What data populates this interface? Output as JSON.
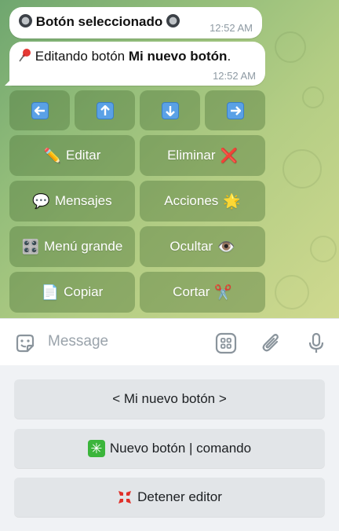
{
  "messages": [
    {
      "icon_left": "radio-circle-icon",
      "text": "Botón seleccionado",
      "icon_right": "radio-circle-icon",
      "time": "12:52 AM"
    },
    {
      "icon": "pushpin-icon",
      "prefix": "Editando botón ",
      "bold": "Mi nuevo botón",
      "suffix": ".",
      "time": "12:52 AM"
    }
  ],
  "inline_keyboard": {
    "arrows": [
      {
        "icon": "arrow-left-icon",
        "glyph": "⬅"
      },
      {
        "icon": "arrow-up-icon",
        "glyph": "⬆"
      },
      {
        "icon": "arrow-down-icon",
        "glyph": "⬇"
      },
      {
        "icon": "arrow-right-icon",
        "glyph": "➡"
      }
    ],
    "buttons": [
      {
        "label": "Editar",
        "icon": "pencil-icon",
        "glyph": "✏️",
        "icon_side": "left"
      },
      {
        "label": "Eliminar",
        "icon": "cross-mark-icon",
        "glyph": "❌",
        "icon_side": "right"
      },
      {
        "label": "Mensajes",
        "icon": "speech-bubble-icon",
        "glyph": "💬",
        "icon_side": "left"
      },
      {
        "label": "Acciones",
        "icon": "sparkle-star-icon",
        "glyph": "🌟",
        "icon_side": "right"
      },
      {
        "label": "Menú grande",
        "icon": "control-knobs-icon",
        "glyph": "🎛️",
        "icon_side": "left"
      },
      {
        "label": "Ocultar",
        "icon": "eye-icon",
        "glyph": "👁️",
        "icon_side": "right"
      },
      {
        "label": "Copiar",
        "icon": "page-icon",
        "glyph": "📄",
        "icon_side": "left"
      },
      {
        "label": "Cortar",
        "icon": "scissors-icon",
        "glyph": "✂️",
        "icon_side": "right"
      }
    ]
  },
  "input": {
    "placeholder": "Message",
    "sticker_icon": "sticker-icon",
    "keyboard_icon": "keyboard-grid-icon",
    "attach_icon": "paperclip-icon",
    "mic_icon": "microphone-icon"
  },
  "reply_keyboard": [
    {
      "label": "< Mi nuevo botón >"
    },
    {
      "label": "Nuevo botón | comando",
      "icon": "eight-spoked-asterisk-icon",
      "glyph": "✳"
    },
    {
      "label": "Detener editor",
      "icon": "anger-symbol-icon",
      "glyph": "💢"
    }
  ],
  "colors": {
    "chat_bg_start": "#6fa66f",
    "chat_bg_end": "#cfd98f",
    "arrow_blue": "#5aa1e6",
    "cross_red": "#e0202a",
    "asterisk_green": "#3bb53b",
    "reply_button_bg": "#e2e5e8"
  }
}
